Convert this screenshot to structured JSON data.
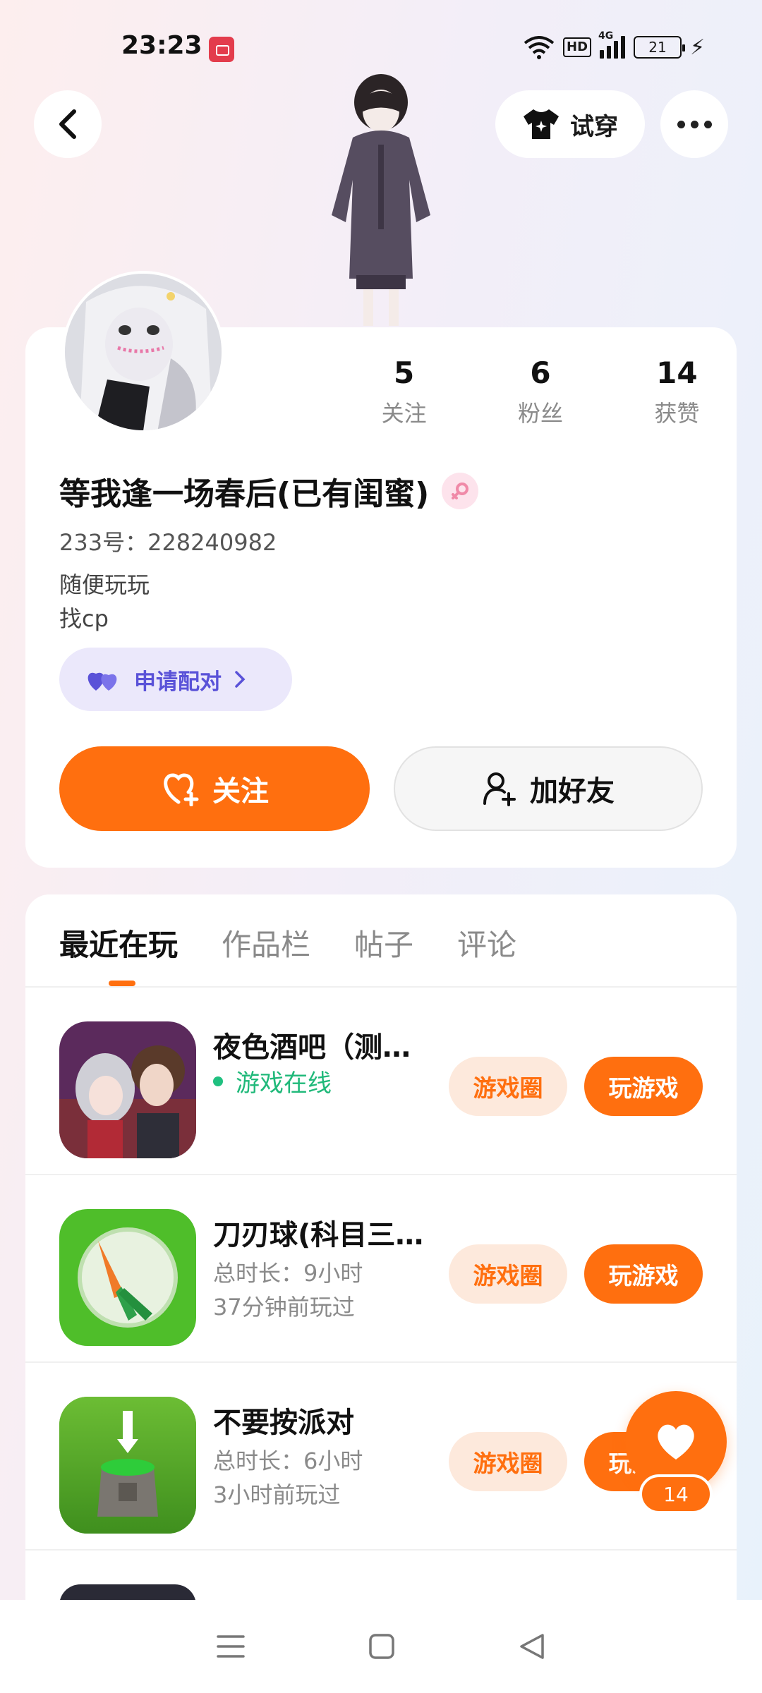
{
  "status_bar": {
    "time": "23:23",
    "hd": "HD",
    "network": "4G",
    "battery": "21"
  },
  "header": {
    "tryon_label": "试穿"
  },
  "profile": {
    "stats": [
      {
        "num": "5",
        "label": "关注"
      },
      {
        "num": "6",
        "label": "粉丝"
      },
      {
        "num": "14",
        "label": "获赞"
      }
    ],
    "nickname": "等我逢一场春后(已有闺蜜)",
    "user_id": "233号：228240982",
    "bio_line1": "随便玩玩",
    "bio_line2": "找cp",
    "pair_label": "申请配对",
    "follow_label": "关注",
    "add_friend_label": "加好友"
  },
  "tabs": [
    "最近在玩",
    "作品栏",
    "帖子",
    "评论"
  ],
  "games": [
    {
      "title": "夜色酒吧（测…",
      "online": "游戏在线",
      "circle_label": "游戏圈",
      "play_label": "玩游戏"
    },
    {
      "title": "刀刃球(科目三…",
      "sub1": "总时长：9小时",
      "sub2": "37分钟前玩过",
      "circle_label": "游戏圈",
      "play_label": "玩游戏"
    },
    {
      "title": "不要按派对",
      "sub1": "总时长：6小时",
      "sub2": "3小时前玩过",
      "circle_label": "游戏圈",
      "play_label": "玩游戏"
    }
  ],
  "like": {
    "count": "14"
  },
  "colors": {
    "accent": "#ff6f0f",
    "pair": "#5a52d8",
    "online": "#20b97a"
  }
}
